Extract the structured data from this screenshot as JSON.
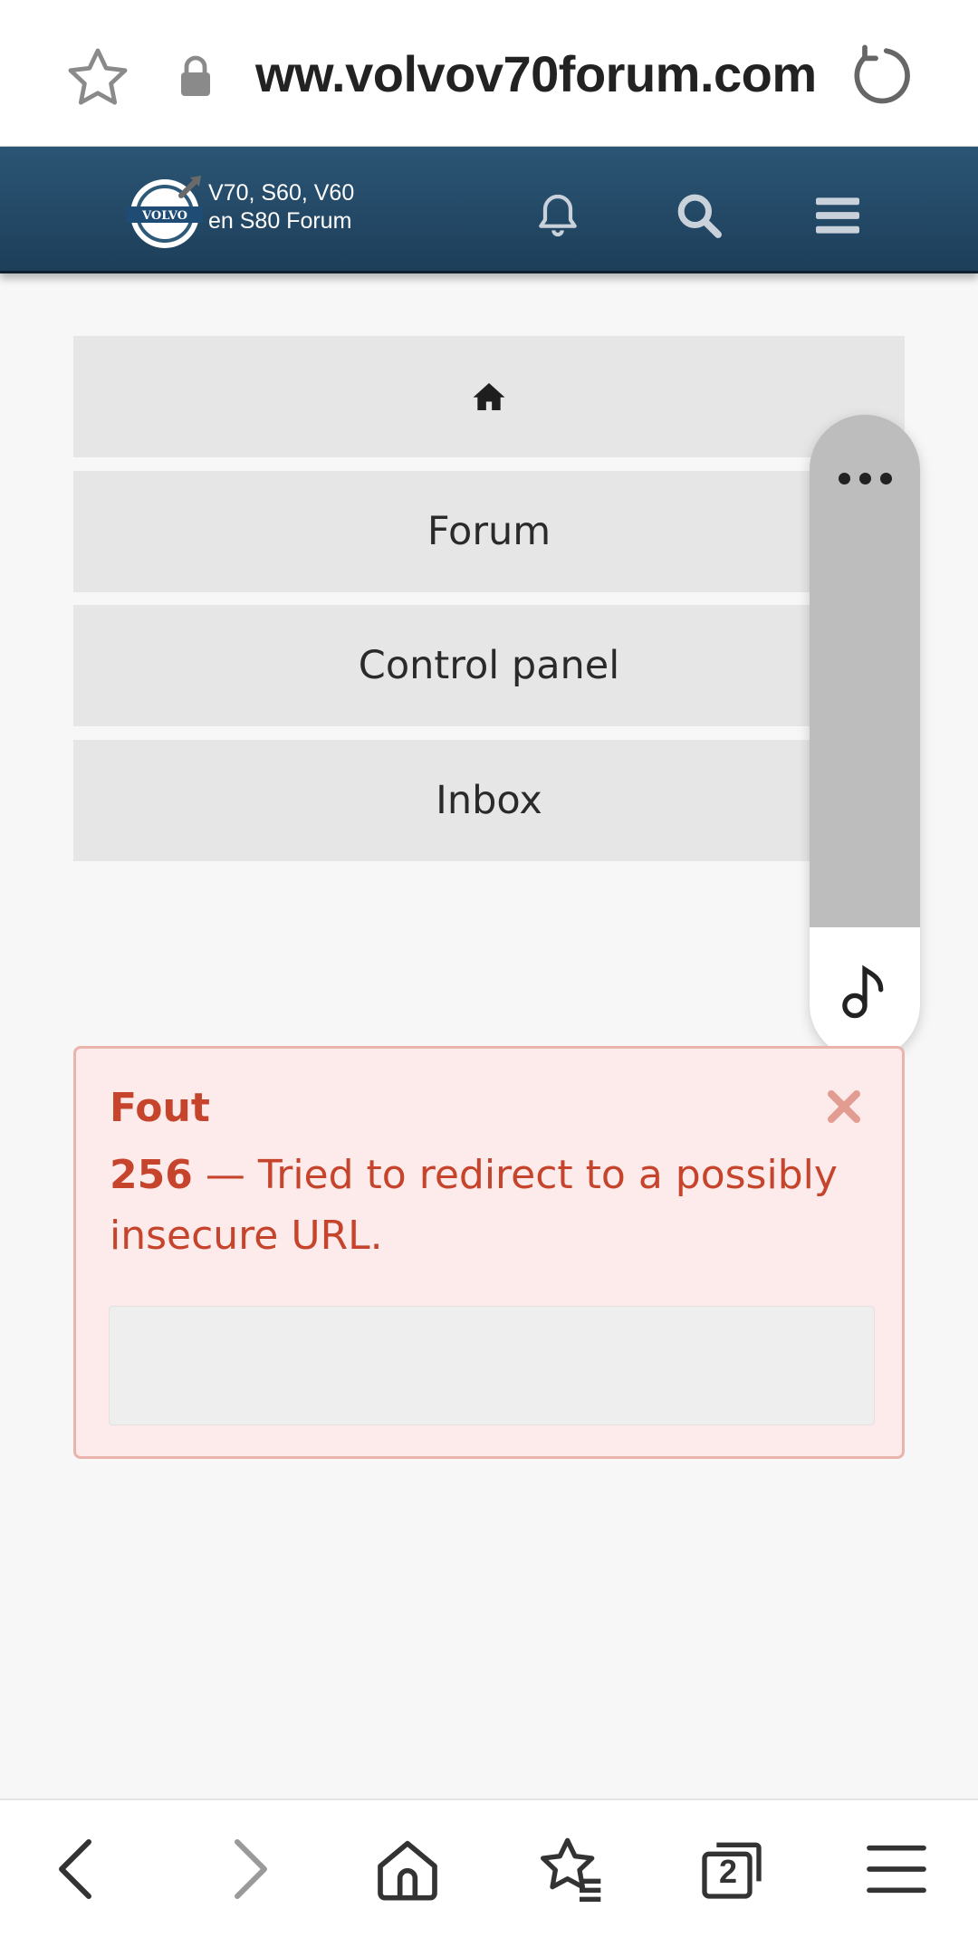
{
  "browser": {
    "url": "ww.volvov70forum.com",
    "tabs_count": "2"
  },
  "header": {
    "logo_text_line1": "V70, S60, V60",
    "logo_text_line2": "en S80 Forum",
    "logo_badge": "VOLVO"
  },
  "nav": {
    "items": [
      {
        "label": "Forum"
      },
      {
        "label": "Control panel"
      },
      {
        "label": "Inbox"
      }
    ]
  },
  "error": {
    "title": "Fout",
    "code": "256",
    "message": " — Tried to redirect to a possibly insecure URL."
  },
  "colors": {
    "header_bg": "#24496a",
    "error_text": "#c5442b",
    "error_bg": "#fdeaea"
  }
}
